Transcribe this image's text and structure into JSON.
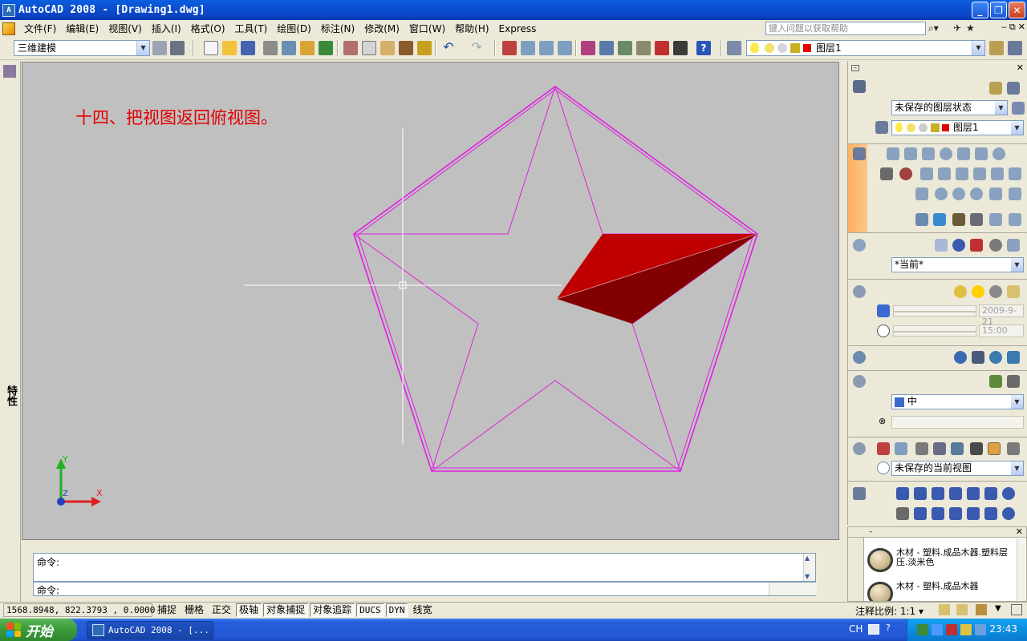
{
  "window": {
    "app_icon": "AutoCAD",
    "title": "AutoCAD 2008 - [Drawing1.dwg]"
  },
  "menubar": {
    "items": [
      "文件(F)",
      "编辑(E)",
      "视图(V)",
      "插入(I)",
      "格式(O)",
      "工具(T)",
      "绘图(D)",
      "标注(N)",
      "修改(M)",
      "窗口(W)",
      "帮助(H)",
      "Express"
    ],
    "help_placeholder": "键入问题以获取帮助"
  },
  "toolbar": {
    "workspace": "三维建模",
    "layer": "图层1"
  },
  "left_strip": {
    "properties_label": "特性"
  },
  "canvas": {
    "annotation": "十四、把视图返回俯视图。",
    "ucs_y": "Y",
    "ucs_x": "X",
    "ucs_z": "Z"
  },
  "palette": {
    "layer_state": "未保存的图层状态",
    "layer_current": "图层1",
    "visual_style": "*当前*",
    "date": "2009-9-21",
    "time": "15:00",
    "view_field": "中",
    "named_view": "未保存的当前视图"
  },
  "materials": {
    "items": [
      "木材 - 塑料.成品木器.塑料层压.淡米色",
      "木材 - 塑料.成品木器"
    ]
  },
  "command": {
    "history_prompt": "命令:",
    "current_prompt": "命令:"
  },
  "statusbar": {
    "coords": "1568.8948, 822.3793 , 0.0000",
    "buttons": [
      "捕捉",
      "栅格",
      "正交",
      "极轴",
      "对象捕捉",
      "对象追踪",
      "DUCS",
      "DYN",
      "线宽"
    ],
    "annotation_scale": "注释比例: 1:1 ▾"
  },
  "taskbar": {
    "start": "开始",
    "task": "AutoCAD 2008 - [...",
    "lang": "CH",
    "clock": "23:43"
  },
  "colors": {
    "wireframe": "#e020e0",
    "solid_face": "#c00000",
    "solid_face_dark": "#820000",
    "canvas_bg": "#c0c0c0",
    "annotation": "#e00000"
  }
}
